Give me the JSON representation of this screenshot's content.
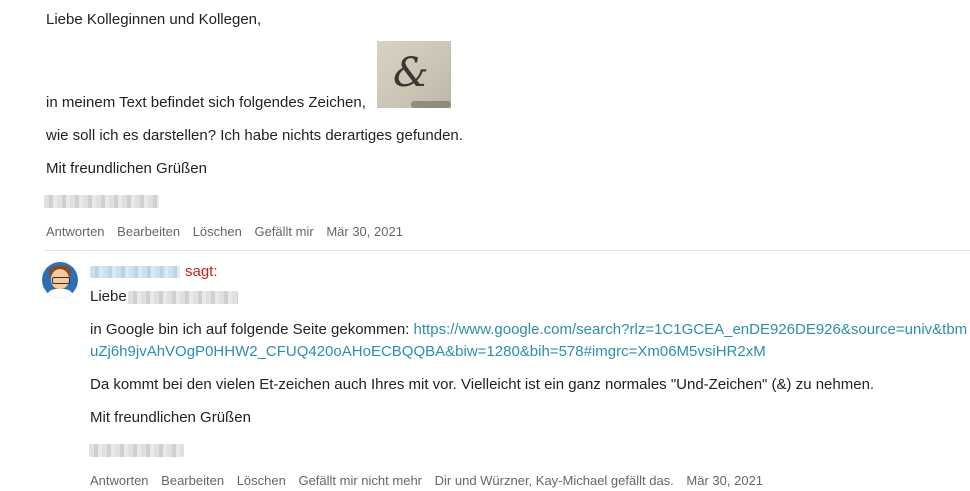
{
  "post": {
    "greeting": "Liebe Kolleginnen und Kollegen,",
    "line_text": "in meinem Text befindet sich folgendes Zeichen,",
    "question": "wie soll ich es darstellen? Ich habe nichts derartiges gefunden.",
    "closing": "Mit freundlichen Grüßen",
    "actions": {
      "reply": "Antworten",
      "edit": "Bearbeiten",
      "delete": "Löschen",
      "like": "Gefällt mir",
      "date": "Mär 30, 2021"
    }
  },
  "reply": {
    "said": "sagt:",
    "greeting": "Liebe",
    "intro": "in Google bin ich auf folgende Seite gekommen: ",
    "link_line1": "https://www.google.com/search?rlz=1C1GCEA_enDE926DE926&source=univ&tbm",
    "link_line2": "uZj6h9jvAhVOgP0HHW2_CFUQ420oAHoECBQQBA&biw=1280&bih=578#imgrc=Xm06M5vsiHR2xM",
    "body": "Da kommt bei den vielen Et-zeichen auch Ihres mit vor. Vielleicht ist ein ganz normales \"Und-Zeichen\" (&) zu nehmen.",
    "closing": "Mit freundlichen Grüßen",
    "actions": {
      "reply": "Antworten",
      "edit": "Bearbeiten",
      "delete": "Löschen",
      "unlike": "Gefällt mir nicht mehr",
      "likes_info": "Dir und Würzner, Kay-Michael gefällt das.",
      "date": "Mär 30, 2021"
    }
  },
  "colors": {
    "author_name": "#c4221b",
    "link": "#2a8fa8",
    "action_text": "#666666"
  },
  "icons": {
    "avatar": "user-avatar-icon"
  }
}
